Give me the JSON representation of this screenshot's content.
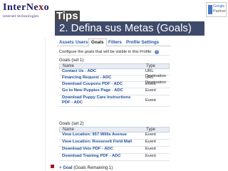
{
  "header": {
    "logo": {
      "part1": "InterNe",
      "part2": "x",
      "part3": "o",
      "tagline": "internet technologies"
    },
    "title": "Tips",
    "subtitle": "2. Defina sus Metas (Goals)",
    "partner_badge": {
      "line1": "Google",
      "line2": "Partner"
    }
  },
  "tabs": [
    "Assets",
    "Users",
    "Goals",
    "Filters",
    "Profile Settings"
  ],
  "active_tab": "Goals",
  "config_text": "Configure the goals that will be visible in this Profile.",
  "goal_sets": [
    {
      "label": "Goals (set 1)",
      "columns": [
        "Name",
        "Type"
      ],
      "rows": [
        {
          "name": "Contact Us - ADC",
          "type": "URL Destination"
        },
        {
          "name": "Financing Request - ADC",
          "type": "URL Destination"
        },
        {
          "name": "Download Coupons PDF - ADC",
          "type": "Event"
        },
        {
          "name": "Go to New Puppies Page - ADC",
          "type": "Event"
        },
        {
          "name": "Download Puppy Care Instructions PDF - ADC",
          "type": "Event"
        }
      ]
    },
    {
      "label": "Goals (set 2)",
      "columns": [
        "Name",
        "Type"
      ],
      "rows": [
        {
          "name": "View Location: 957 Willis Avenue",
          "type": "Event"
        },
        {
          "name": "View Location: Roosevelt Field Mall",
          "type": "Event"
        },
        {
          "name": "Download Vets PDF - ADC",
          "type": "Event"
        },
        {
          "name": "Download Training PDF - ADC",
          "type": "Event"
        }
      ]
    }
  ],
  "add_goal": {
    "link": "+ Goal",
    "note": "(Goals Remaining 1)"
  },
  "colors": {
    "accent_red": "#a11b1b",
    "subtitle_bg": "#3f4a6a",
    "link_blue": "#1f4e9c",
    "logo_navy": "#1a1a6a"
  }
}
